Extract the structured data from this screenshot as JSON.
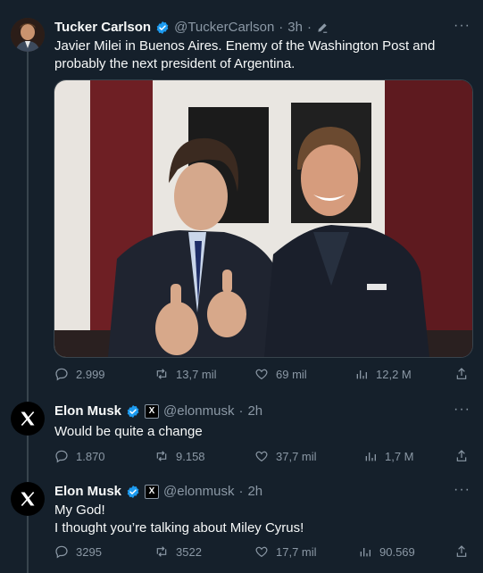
{
  "tweets": [
    {
      "name": "Tucker Carlson",
      "handle": "@TuckerCarlson",
      "time": "3h",
      "text": "Javier Milei in Buenos Aires. Enemy of the Washington Post and probably the next president of Argentina.",
      "stats": {
        "replies": "2.999",
        "retweets": "13,7 mil",
        "likes": "69 mil",
        "views": "12,2 M"
      }
    },
    {
      "name": "Elon Musk",
      "handle": "@elonmusk",
      "time": "2h",
      "affiliate": "X",
      "text": "Would be quite a change",
      "stats": {
        "replies": "1.870",
        "retweets": "9.158",
        "likes": "37,7 mil",
        "views": "1,7 M"
      }
    },
    {
      "name": "Elon Musk",
      "handle": "@elonmusk",
      "time": "2h",
      "affiliate": "X",
      "text": "My God!\nI thought you’re talking about Miley Cyrus!",
      "stats": {
        "replies": "3295",
        "retweets": "3522",
        "likes": "17,7 mil",
        "views": "90.569"
      }
    }
  ],
  "ui": {
    "separator": "·",
    "more": "···",
    "x_logo": "X"
  },
  "colors": {
    "background": "#15202b",
    "verified": "#1d9bf0",
    "muted": "#8b98a5",
    "text": "#f7f9f9"
  },
  "icons": [
    "verified-badge-icon",
    "edit-pencil-icon",
    "more-icon",
    "reply-icon",
    "retweet-icon",
    "like-icon",
    "views-icon",
    "share-icon",
    "x-logo-icon"
  ]
}
